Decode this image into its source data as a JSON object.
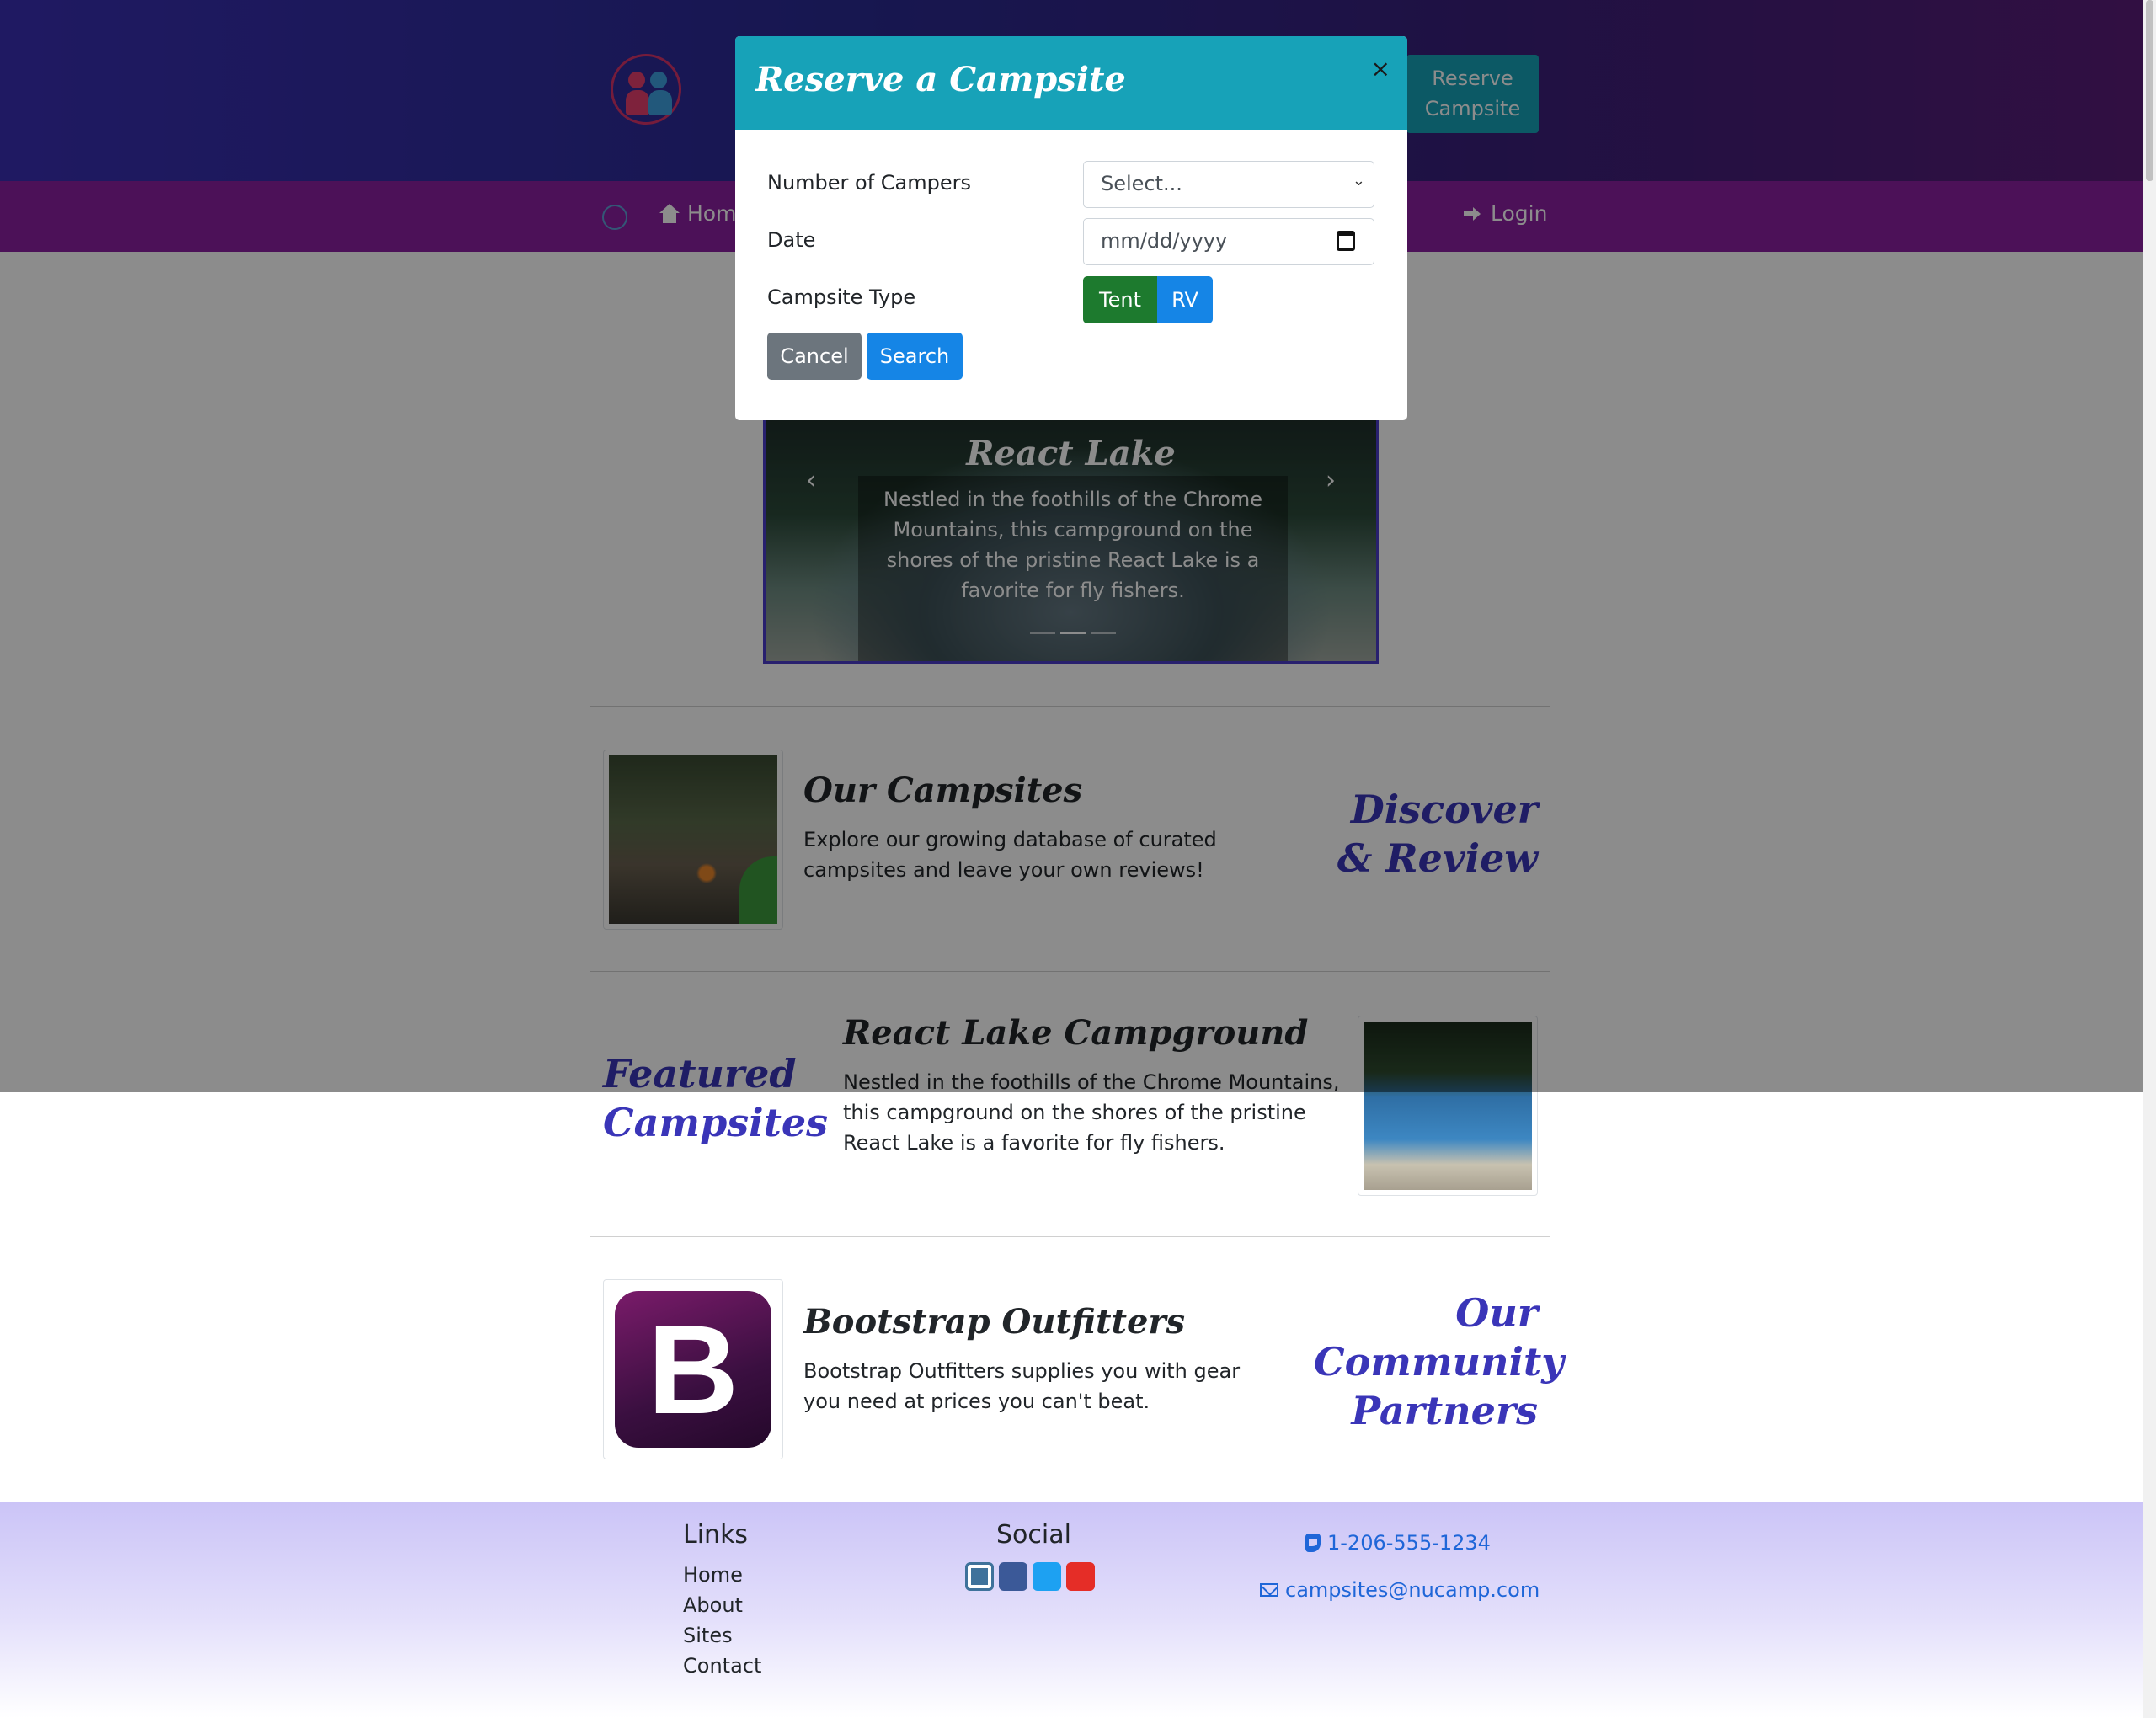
{
  "header": {
    "reserve_button": "Reserve Campsite"
  },
  "navbar": {
    "home": "Home",
    "login": "Login"
  },
  "carousel": {
    "title": "React Lake",
    "text": "Nestled in the foothills of the Chrome Mountains, this campground on the shores of the pristine React Lake is a favorite for fly fishers.",
    "slides": 3,
    "active_slide": 2
  },
  "sections": [
    {
      "title": "Our Campsites",
      "text": "Explore our growing database of curated campsites and leave your own reviews!",
      "side_heading": "Discover & Review",
      "image": "forest-campsite"
    },
    {
      "title": "React Lake Campground",
      "text": "Nestled in the foothills of the Chrome Mountains, this campground on the shores of the pristine React Lake is a favorite for fly fishers.",
      "side_heading": "Featured Campsites",
      "image": "react-lake"
    },
    {
      "title": "Bootstrap Outfitters",
      "text": "Bootstrap Outfitters supplies you with gear you need at prices you can't beat.",
      "side_heading": "Our Community Partners",
      "image": "bootstrap-logo",
      "logo_letter": "B"
    }
  ],
  "footer": {
    "links_heading": "Links",
    "links": [
      "Home",
      "About",
      "Sites",
      "Contact"
    ],
    "social_heading": "Social",
    "social_icons": [
      "instagram-icon",
      "facebook-icon",
      "twitter-icon",
      "youtube-icon"
    ],
    "phone": "1-206-555-1234",
    "email": "campsites@nucamp.com"
  },
  "modal": {
    "title": "Reserve a Campsite",
    "close": "×",
    "fields": {
      "campers_label": "Number of Campers",
      "campers_value": "Select...",
      "date_label": "Date",
      "date_placeholder": "mm/dd/yyyy",
      "type_label": "Campsite Type"
    },
    "type_options": [
      "Tent",
      "RV"
    ],
    "cancel": "Cancel",
    "search": "Search"
  },
  "colors": {
    "modal_header": "#17a2b8",
    "tent": "#1d7a2e",
    "rv": "#1585e6",
    "cancel": "#6c757d",
    "accent_heading": "#3a35b8",
    "navbar": "#8a1fa0"
  }
}
